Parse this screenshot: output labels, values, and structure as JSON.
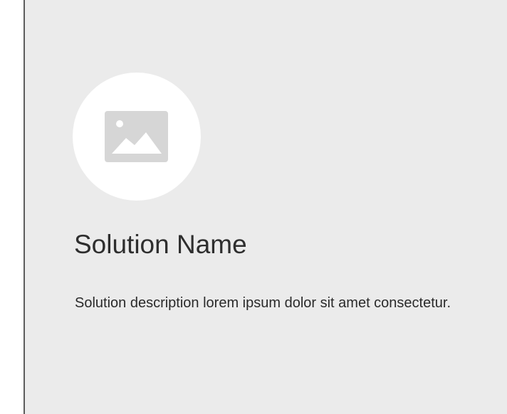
{
  "card": {
    "image_icon": "image-placeholder-icon",
    "title": "Solution Name",
    "description": "Solution description lorem ipsum dolor sit amet consectetur."
  },
  "colors": {
    "card_background": "#ebebeb",
    "card_border": "#5c5c5c",
    "circle": "#ffffff",
    "icon": "#d6d6d6",
    "text": "#2e2e2e"
  }
}
